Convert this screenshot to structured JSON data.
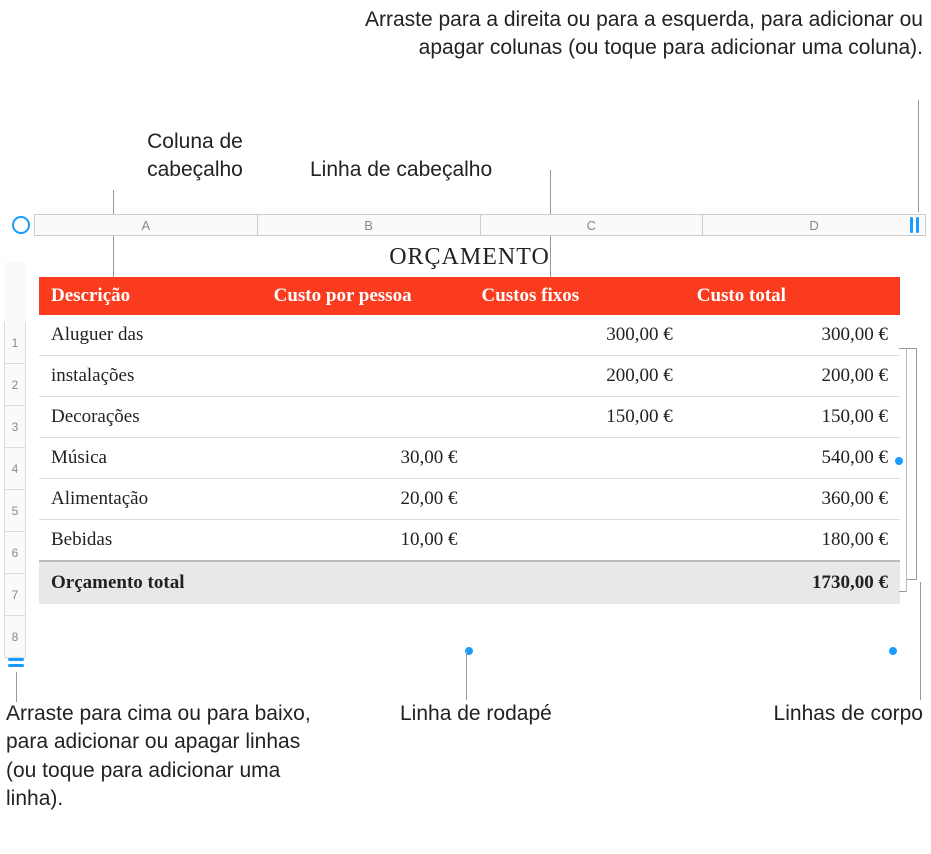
{
  "callouts": {
    "top_right": "Arraste para a direita ou para a esquerda, para adicionar ou apagar colunas (ou toque para adicionar uma coluna).",
    "header_column": "Coluna de cabeçalho",
    "header_row": "Linha de cabeçalho",
    "bottom_left": "Arraste para cima ou para baixo, para adicionar ou apagar linhas (ou toque para adicionar uma linha).",
    "footer_row": "Linha de rodapé",
    "body_rows": "Linhas de corpo"
  },
  "columns": [
    "A",
    "B",
    "C",
    "D"
  ],
  "row_numbers": [
    "1",
    "2",
    "3",
    "4",
    "5",
    "6",
    "7",
    "8"
  ],
  "table": {
    "title": "ORÇAMENTO",
    "headers": {
      "desc": "Descrição",
      "per_person": "Custo por pessoa",
      "fixed": "Custos fixos",
      "total": "Custo total"
    },
    "rows": [
      {
        "desc": "Aluguer das",
        "per_person": "",
        "fixed": "300,00 €",
        "total": "300,00 €"
      },
      {
        "desc": "instalações",
        "per_person": "",
        "fixed": "200,00 €",
        "total": "200,00 €"
      },
      {
        "desc": "Decorações",
        "per_person": "",
        "fixed": "150,00 €",
        "total": "150,00 €"
      },
      {
        "desc": "Música",
        "per_person": "30,00 €",
        "fixed": "",
        "total": "540,00 €"
      },
      {
        "desc": "Alimentação",
        "per_person": "20,00 €",
        "fixed": "",
        "total": "360,00 €"
      },
      {
        "desc": "Bebidas",
        "per_person": "10,00 €",
        "fixed": "",
        "total": "180,00 €"
      }
    ],
    "footer": {
      "label": "Orçamento total",
      "total": "1730,00 €"
    }
  },
  "chart_data": {
    "type": "table",
    "title": "ORÇAMENTO",
    "columns": [
      "Descrição",
      "Custo por pessoa",
      "Custos fixos",
      "Custo total"
    ],
    "rows": [
      [
        "Aluguer das",
        null,
        300.0,
        300.0
      ],
      [
        "instalações",
        null,
        200.0,
        200.0
      ],
      [
        "Decorações",
        null,
        150.0,
        150.0
      ],
      [
        "Música",
        30.0,
        null,
        540.0
      ],
      [
        "Alimentação",
        20.0,
        null,
        360.0
      ],
      [
        "Bebidas",
        10.0,
        null,
        180.0
      ]
    ],
    "footer": [
      "Orçamento total",
      null,
      null,
      1730.0
    ],
    "currency": "€"
  }
}
